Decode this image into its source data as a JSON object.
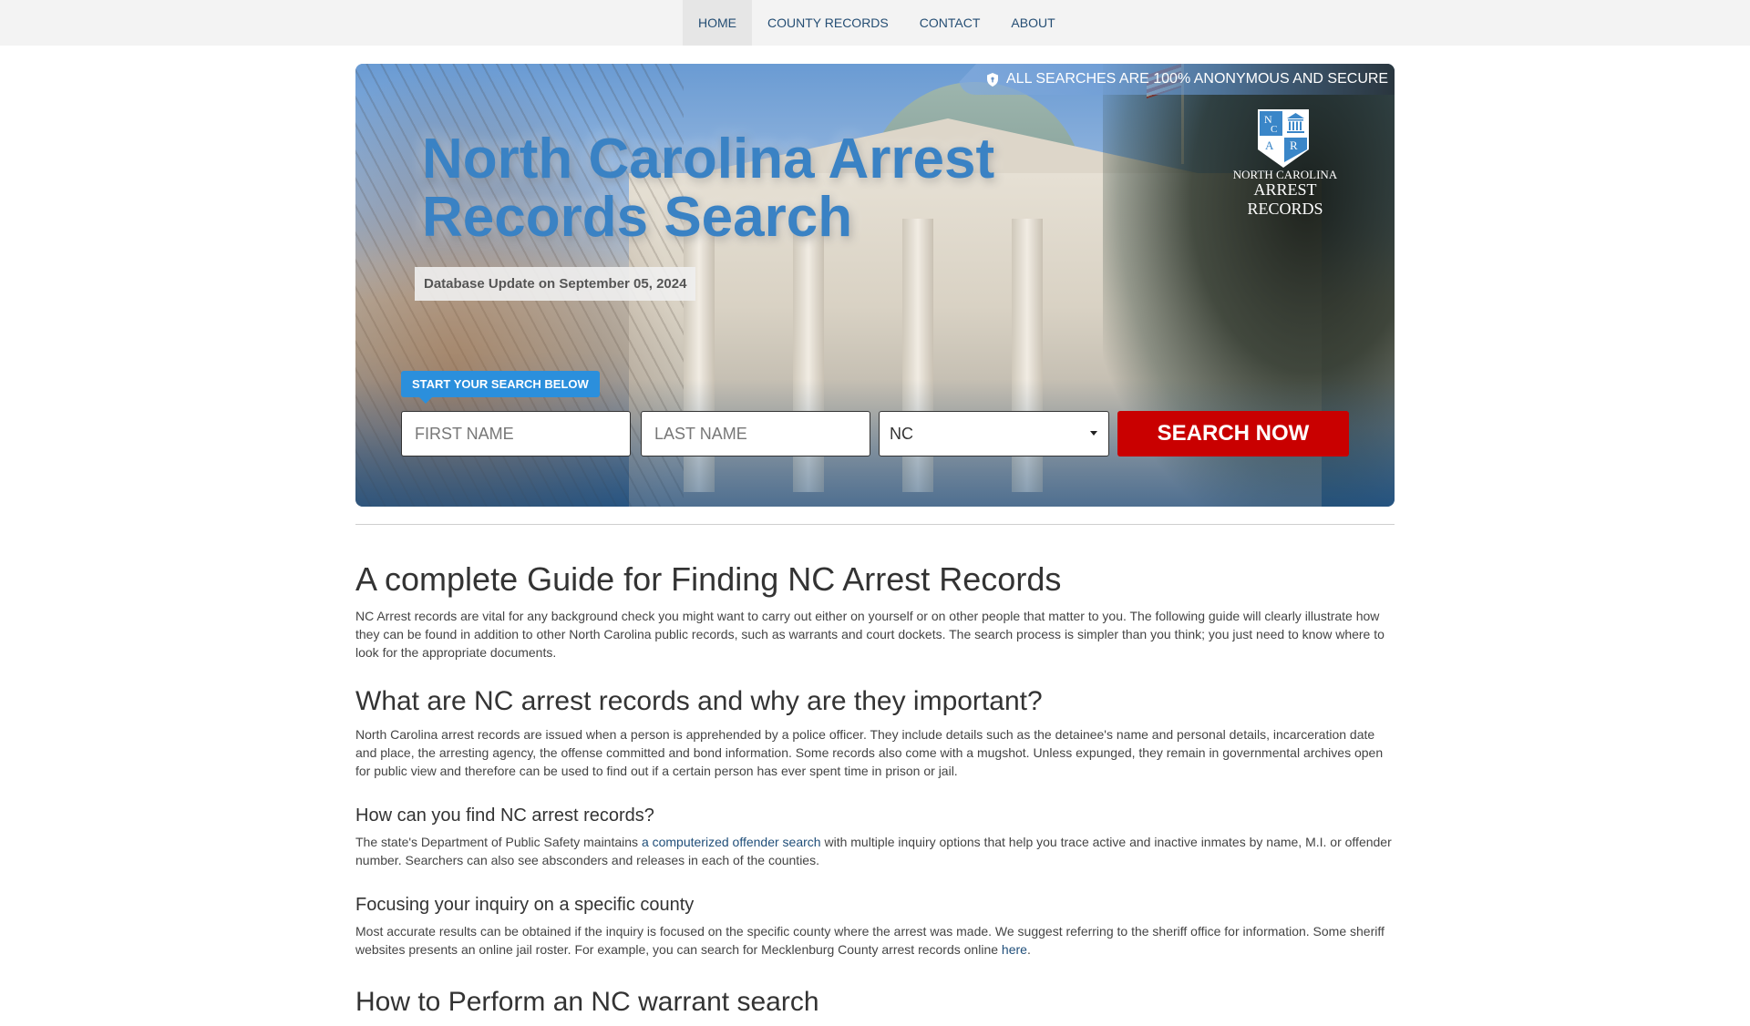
{
  "nav": {
    "items": [
      {
        "label": "HOME",
        "active": true
      },
      {
        "label": "COUNTY RECORDS",
        "active": false
      },
      {
        "label": "CONTACT",
        "active": false
      },
      {
        "label": "ABOUT",
        "active": false
      }
    ]
  },
  "hero": {
    "secure_icon": "shield-lock-icon",
    "secure_text": "ALL SEARCHES ARE 100% ANONYMOUS AND SECURE",
    "logo": {
      "letters": [
        "N",
        "C",
        "A",
        "R"
      ],
      "line1": "NORTH CAROLINA",
      "line2": "ARREST RECORDS"
    },
    "title": "North Carolina Arrest Records Search",
    "db_update": "Database Update on September 05, 2024",
    "start_badge": "START YOUR SEARCH BELOW",
    "form": {
      "first_name_placeholder": "FIRST NAME",
      "first_name_value": "",
      "last_name_placeholder": "LAST NAME",
      "last_name_value": "",
      "state_selected": "NC",
      "search_button": "SEARCH NOW"
    }
  },
  "colors": {
    "title_blue": "#3a82c4",
    "badge_blue": "#2b8fdc",
    "search_red": "#c90000",
    "link_navy": "#1f4e79",
    "nav_text": "#254e74"
  },
  "content": {
    "h1": "A complete Guide for Finding NC Arrest Records",
    "p1": "NC Arrest records are vital for any background check you might want to carry out either on yourself or on other people that matter to you. The following guide will clearly illustrate how they can be found in addition to other North Carolina public records, such as warrants and court dockets. The search process is simpler than you think; you just need to know where to look for the appropriate documents.",
    "h2_what": "What are NC arrest records and why are they important?",
    "p_what": "North Carolina arrest records are issued when a person is apprehended by a police officer. They include details such as the detainee's name and personal details, incarceration date and place, the arresting agency, the offense committed and bond information. Some records also come with a mugshot. Unless expunged, they remain in governmental archives open for public view and therefore can be used to find out if a certain person has ever spent time in prison or jail.",
    "h3_how": "How can you find NC arrest records?",
    "p_how_before": "The state's Department of Public Safety maintains ",
    "p_how_link": "a computerized offender search",
    "p_how_after": " with multiple inquiry options that help you trace active and inactive inmates by name, M.I. or offender number. Searchers can also see absconders and releases in each of the counties.",
    "h3_county": "Focusing your inquiry on a specific county",
    "p_county_before": "Most accurate results can be obtained if the inquiry is focused on the specific county where the arrest was made. We suggest referring to the sheriff office for information. Some sheriff websites presents an online jail roster. For example, you can search for Mecklenburg County arrest records online ",
    "p_county_link": "here",
    "p_county_after": ".",
    "h2_warrant": "How to Perform an NC warrant search"
  }
}
